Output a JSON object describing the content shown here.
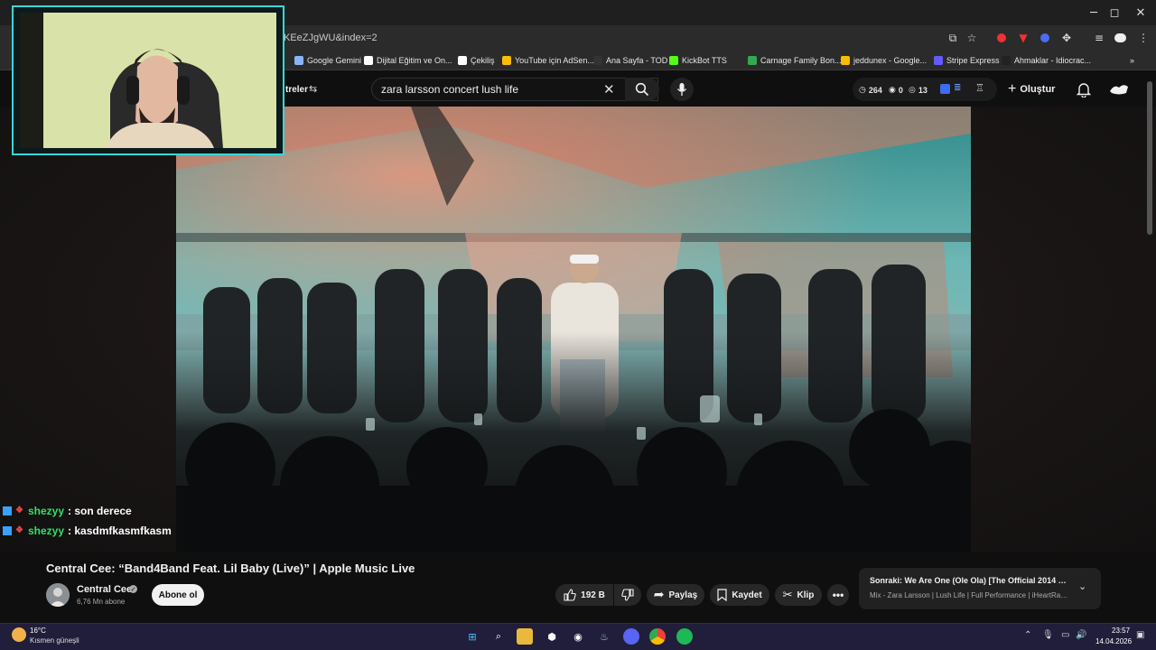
{
  "browser": {
    "url": "KEeZJgWU&index=2",
    "window_controls": {
      "minimize": "─",
      "maximize": "◻",
      "close": "✕"
    },
    "bookmarks": [
      {
        "label": "Google Gemini",
        "color": "#8ab4f8"
      },
      {
        "label": "Dijital Eğitim ve On...",
        "color": "#ffffff"
      },
      {
        "label": "Çekiliş",
        "color": "#ffffff"
      },
      {
        "label": "YouTube için AdSen...",
        "color": "#fbbc04"
      },
      {
        "label": "Ana Sayfa - TOD",
        "color": "#333333"
      },
      {
        "label": "KickBot TTS",
        "color": "#53fc18"
      },
      {
        "label": "Carnage Family Bon...",
        "color": "#34a853"
      },
      {
        "label": "jeddunex - Google...",
        "color": "#fbbc04"
      },
      {
        "label": "Stripe Express",
        "color": "#635bff"
      },
      {
        "label": "Ahmaklar - Idiocrac...",
        "color": "#222222"
      }
    ],
    "more_bookmarks": "»"
  },
  "youtube": {
    "filters_label": "treler",
    "search_query": "zara larsson concert lush life",
    "stats": {
      "views": "264",
      "second": "0",
      "third": "13"
    },
    "create_label": "Oluştur",
    "video": {
      "title": "Central Cee: “Band4Band Feat. Lil Baby (Live)” | Apple Music Live",
      "channel": "Central Cee",
      "subscribers": "6,76 Mn abone",
      "subscribe_label": "Abone ol",
      "likes": "192 B",
      "share_label": "Paylaş",
      "save_label": "Kaydet",
      "clip_label": "Klip"
    },
    "next": {
      "label": "Sonraki:",
      "title": "We Are One (Ole Ola) [The Official 2014 FIF...",
      "subtitle": "Mix - Zara Larsson | Lush Life | Full Performance | iHeartRadi..."
    }
  },
  "chat": [
    {
      "user": "shezyy",
      "message": ": son derece"
    },
    {
      "user": "shezyy",
      "message": ": kasdmfkasmfkasm"
    }
  ],
  "taskbar": {
    "weather_temp": "16°C",
    "weather_desc": "Kısmen güneşli",
    "time": "23:57",
    "date": "14.04.2026"
  },
  "colors": {
    "accent_cyan": "#3bd6d6",
    "chat_user": "#2ee06a",
    "taskbar": "#201e3a"
  }
}
